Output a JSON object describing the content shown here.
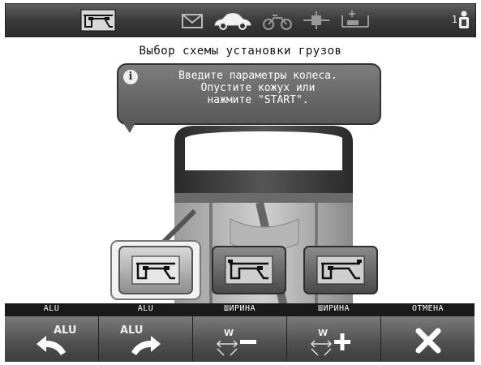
{
  "top_bar": {
    "icons": [
      "wheel-weight-scheme-icon",
      "envelope-icon",
      "car-icon",
      "motorcycle-icon",
      "clip-weight-icon",
      "adhesive-weight-icon"
    ],
    "user_number": "1"
  },
  "title": "Выбор схемы установки грузов",
  "info": {
    "icon": "i",
    "lines": [
      "Введите параметры колеса.",
      "Опустите кожух или",
      "нажмите \"START\"."
    ]
  },
  "modes": [
    {
      "name": "mode-adhesive-both",
      "selected": true
    },
    {
      "name": "mode-clip-adhesive",
      "selected": false
    },
    {
      "name": "mode-adhesive-clip",
      "selected": false
    }
  ],
  "function_keys": [
    {
      "label": "ALU",
      "icon_text": "ALU"
    },
    {
      "label": "ALU",
      "icon_text": "ALU"
    },
    {
      "label": "ШИРИНА",
      "icon_text": "W"
    },
    {
      "label": "ШИРИНА",
      "icon_text": "W"
    },
    {
      "label": "ОТМЕНА",
      "icon_text": ""
    }
  ],
  "colors": {
    "bar": "#3a3a3a",
    "bubble": "#6a6a6a",
    "accent_arrow": "#ffffff"
  }
}
